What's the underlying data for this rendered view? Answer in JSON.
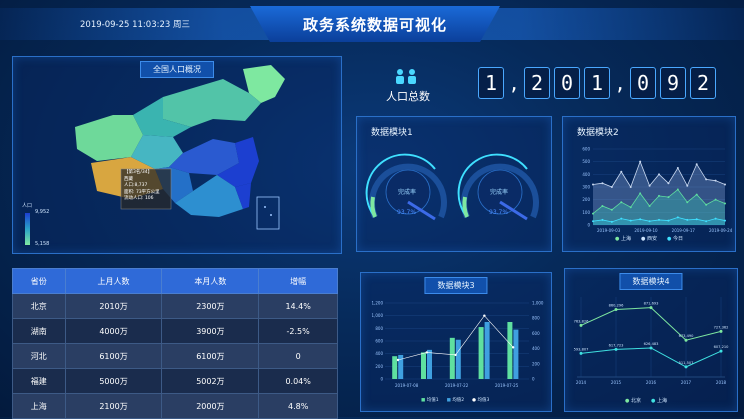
{
  "header": {
    "datetime": "2019-09-25 11:03:23 周三",
    "title": "政务系统数据可视化"
  },
  "map_panel": {
    "title": "全国人口概况",
    "legend_max": "9,952",
    "legend_min": "5,158",
    "legend_label": "人口",
    "tooltip": {
      "line1": "【第3名/34】",
      "line2": "西藏",
      "line3": "人口:8,737",
      "line4": "面积: 73平方公里",
      "line5": "流动人口: 106"
    },
    "colors": {
      "high": "#1c3fd0",
      "mid": "#2aa2c8",
      "low": "#7ee8a0",
      "highlight": "#d8a640"
    }
  },
  "population": {
    "label": "人口总数",
    "digits": [
      "1",
      ",",
      "2",
      "0",
      "1",
      ",",
      "0",
      "9",
      "2"
    ]
  },
  "module1": {
    "title": "数据模块1",
    "gauges": [
      {
        "center_label": "完成率",
        "value_text": "93.7%"
      },
      {
        "center_label": "完成率",
        "value_text": "93.7%"
      }
    ]
  },
  "module2": {
    "title": "数据模块2",
    "legend": [
      "上海",
      "西安",
      "今日"
    ]
  },
  "module3": {
    "title": "数据模块3",
    "legend": [
      "均值1",
      "均值2",
      "均值3"
    ]
  },
  "module4": {
    "title": "数据模块4",
    "legend": [
      "北京",
      "上海"
    ]
  },
  "table": {
    "headers": [
      "省份",
      "上月人数",
      "本月人数",
      "增幅"
    ],
    "rows": [
      [
        "北京",
        "2010万",
        "2300万",
        "14.4%"
      ],
      [
        "湖南",
        "4000万",
        "3900万",
        "-2.5%"
      ],
      [
        "河北",
        "6100万",
        "6100万",
        "0"
      ],
      [
        "福建",
        "5000万",
        "5002万",
        "0.04%"
      ],
      [
        "上海",
        "2100万",
        "2000万",
        "4.8%"
      ]
    ]
  },
  "chart_data": [
    {
      "type": "area",
      "title": "数据模块2",
      "x": [
        "2019-09-03",
        "2019-09-10",
        "2019-09-17",
        "2019-09-24"
      ],
      "ylim": [
        0,
        600
      ],
      "y_ticks": [
        "0",
        "100",
        "200",
        "300",
        "400",
        "500",
        "600"
      ],
      "series": [
        {
          "name": "上海",
          "values": [
            320,
            330,
            300,
            420,
            300,
            500,
            310,
            400,
            330,
            450,
            310,
            480,
            360,
            350,
            320
          ]
        },
        {
          "name": "西安",
          "values": [
            90,
            150,
            120,
            180,
            140,
            250,
            150,
            230,
            220,
            280,
            180,
            240,
            160,
            200,
            170
          ]
        },
        {
          "name": "今日",
          "values": [
            30,
            40,
            25,
            50,
            35,
            45,
            30,
            40,
            35,
            60,
            40,
            45,
            30,
            50,
            35
          ]
        }
      ]
    },
    {
      "type": "bar",
      "title": "数据模块3",
      "x": [
        "2019-07-08",
        "2019-07-22",
        "2019-07-25"
      ],
      "y_ticks_left": [
        "0",
        "200",
        "400",
        "600",
        "800",
        "1,000",
        "1,200"
      ],
      "y_ticks_right": [
        "0",
        "200",
        "400",
        "600",
        "800",
        "1,000"
      ],
      "series": [
        {
          "name": "均值1",
          "values": [
            360,
            420,
            650,
            820,
            900
          ]
        },
        {
          "name": "均值2",
          "values": [
            380,
            460,
            620,
            900,
            780
          ]
        },
        {
          "name": "均值3",
          "values": [
            300,
            420,
            380,
            1000,
            500
          ]
        }
      ]
    },
    {
      "type": "line",
      "title": "数据模块4",
      "categories": [
        "2014",
        "2015",
        "2016",
        "2017",
        "2018"
      ],
      "series": [
        {
          "name": "北京",
          "values": [
            763826,
            860296,
            871693,
            673490,
            727362
          ],
          "labels": [
            "763,826",
            "860,296",
            "871,693",
            "673,490",
            "727,362"
          ]
        },
        {
          "name": "上海",
          "values": [
            593807,
            617723,
            626483,
            511507,
            607210
          ],
          "labels": [
            "593,807",
            "617,723",
            "626,483",
            "511,507",
            "607,210"
          ]
        }
      ]
    }
  ]
}
